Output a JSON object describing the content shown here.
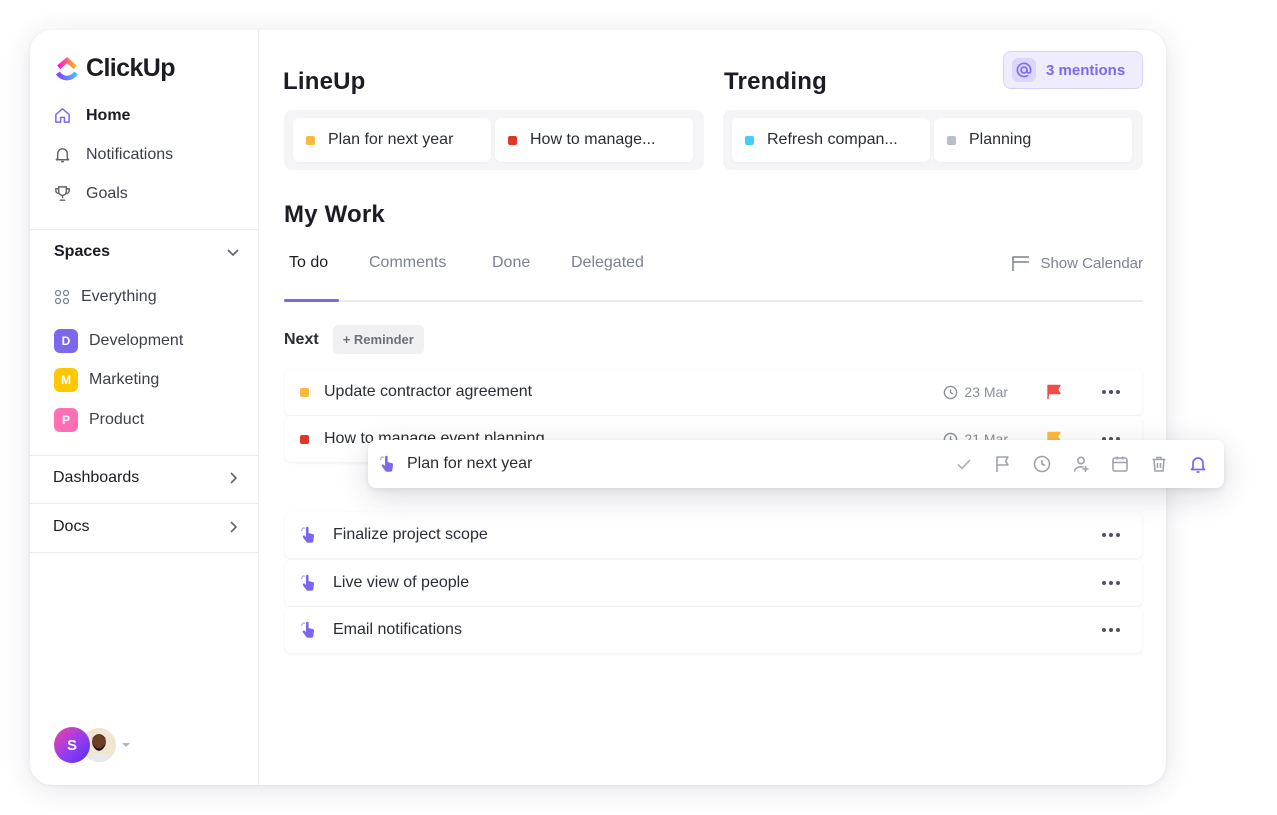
{
  "app": {
    "brand": "ClickUp"
  },
  "sidebar": {
    "nav": [
      {
        "label": "Home",
        "icon": "home-icon",
        "active": true
      },
      {
        "label": "Notifications",
        "icon": "bell-icon",
        "active": false
      },
      {
        "label": "Goals",
        "icon": "trophy-icon",
        "active": false
      }
    ],
    "spaces_label": "Spaces",
    "everything_label": "Everything",
    "spaces": [
      {
        "initial": "D",
        "label": "Development",
        "color": "#7b68ee"
      },
      {
        "initial": "M",
        "label": "Marketing",
        "color": "#ffc800"
      },
      {
        "initial": "P",
        "label": "Product",
        "color": "#ff6fb1"
      }
    ],
    "dashboards_label": "Dashboards",
    "docs_label": "Docs",
    "user_initial": "S"
  },
  "lineup": {
    "title": "LineUp",
    "items": [
      {
        "label": "Plan for next year",
        "color": "#fdb93d"
      },
      {
        "label": "How to manage...",
        "color": "#e0372b"
      }
    ]
  },
  "trending": {
    "title": "Trending",
    "items": [
      {
        "label": "Refresh compan...",
        "color": "#49ccf9"
      },
      {
        "label": "Planning",
        "color": "#b9bec7"
      }
    ]
  },
  "mentions": {
    "label": "3 mentions"
  },
  "mywork": {
    "title": "My Work",
    "tabs": [
      "To do",
      "Comments",
      "Done",
      "Delegated"
    ],
    "active_tab": "To do",
    "show_calendar": "Show Calendar",
    "next_label": "Next",
    "reminder_label": "+ Reminder",
    "tasks": [
      {
        "label": "Update contractor agreement",
        "status_color": "#fdb93d",
        "date": "23 Mar",
        "flag_color": "#f04b4b"
      },
      {
        "label": "How to manage event planning",
        "status_color": "#e0372b",
        "date": "21 Mar",
        "flag_color": "#fdb93d"
      }
    ],
    "dragging_task": {
      "label": "Plan for next year",
      "actions": [
        "check-icon",
        "flag-icon",
        "clock-icon",
        "assign-user-icon",
        "calendar-icon",
        "trash-icon",
        "bell-icon"
      ]
    },
    "reminders": [
      {
        "label": "Finalize project scope"
      },
      {
        "label": "Live view of people"
      },
      {
        "label": "Email notifications"
      }
    ]
  }
}
